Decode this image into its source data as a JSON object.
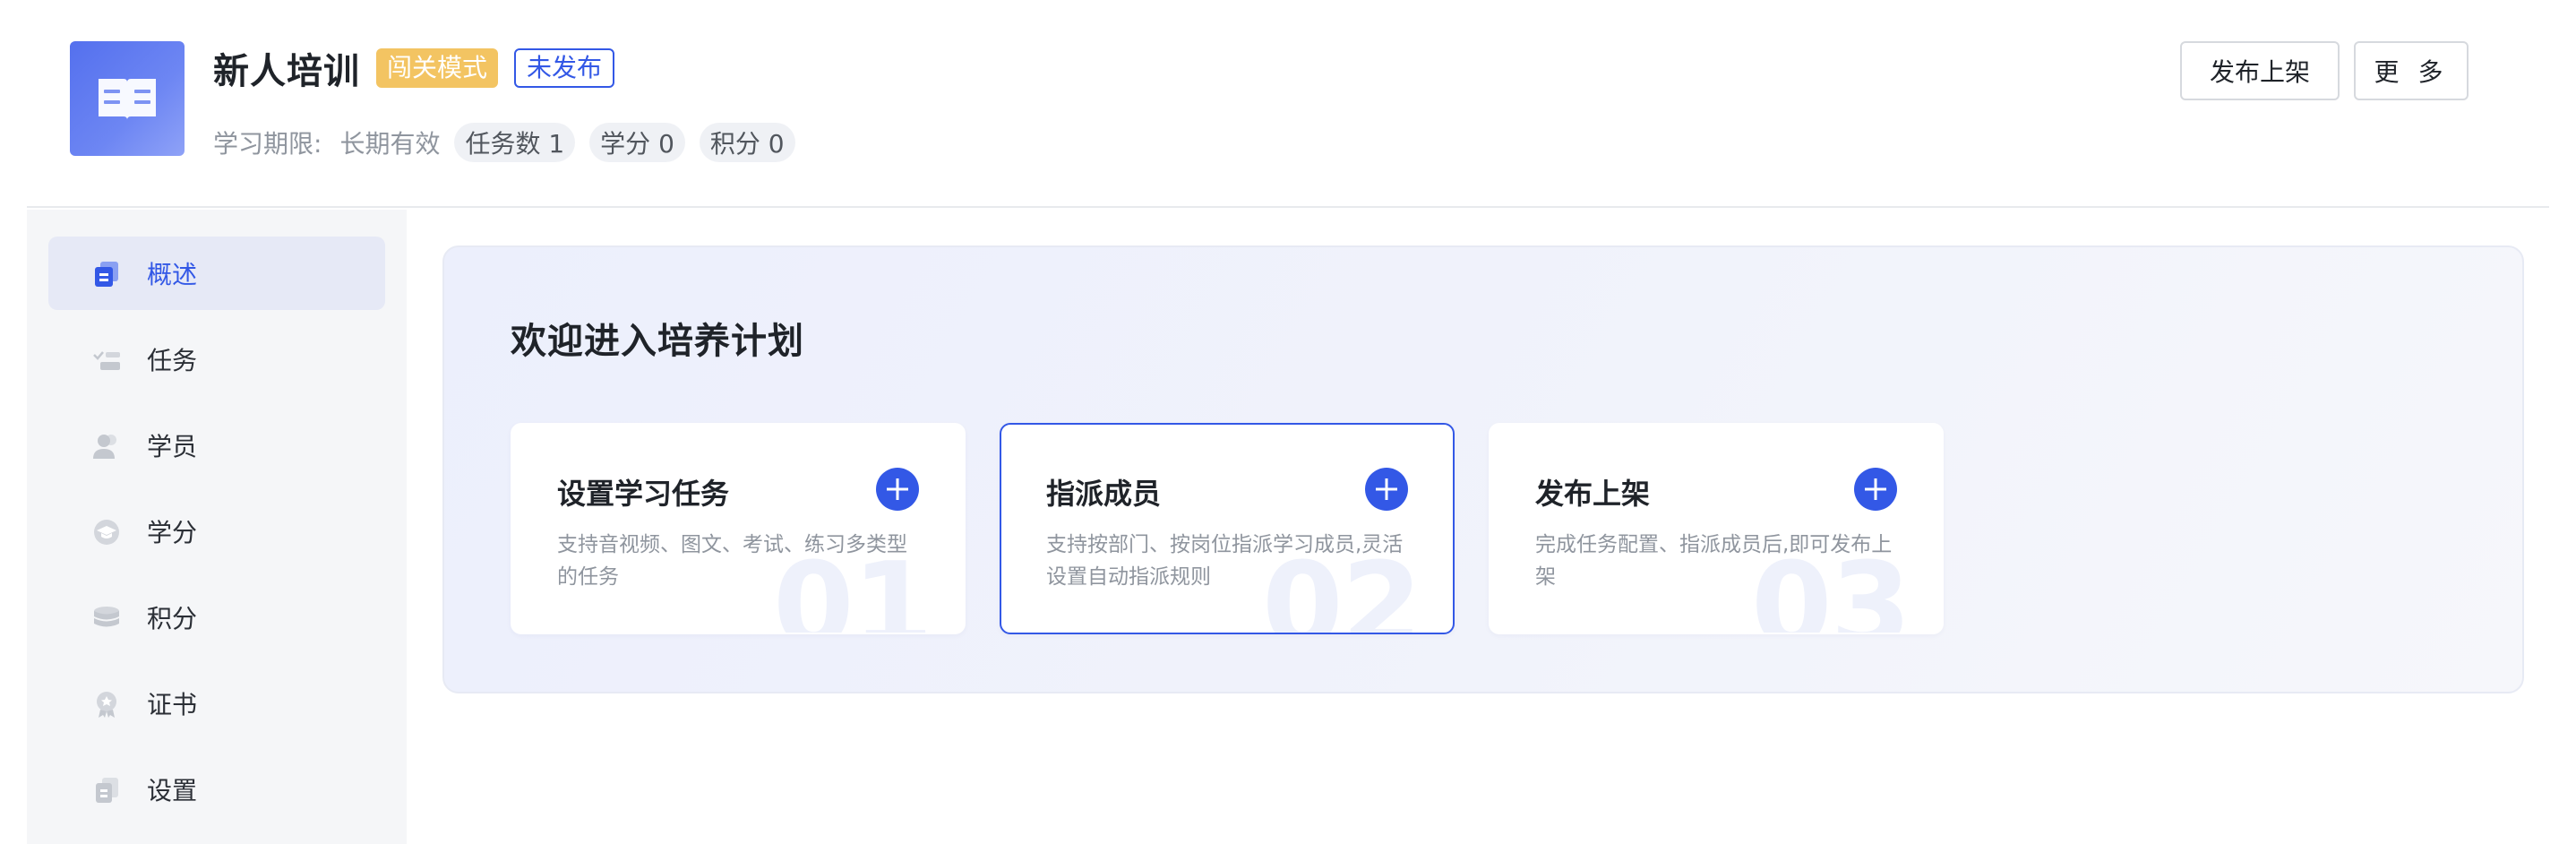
{
  "course": {
    "title": "新人培训",
    "mode_tag": "闯关模式",
    "status_tag": "未发布",
    "period_label": "学习期限:",
    "period_value": "长期有效",
    "pills": {
      "tasks": "任务数 1",
      "credits": "学分 0",
      "points": "积分 0"
    },
    "cover_icon": "open-book-icon"
  },
  "header_actions": {
    "publish": "发布上架",
    "more": "更 多"
  },
  "sidebar": {
    "items": [
      {
        "label": "概述",
        "icon": "overview-icon",
        "active": true
      },
      {
        "label": "任务",
        "icon": "task-list-icon",
        "active": false
      },
      {
        "label": "学员",
        "icon": "users-icon",
        "active": false
      },
      {
        "label": "学分",
        "icon": "graduation-cap-icon",
        "active": false
      },
      {
        "label": "积分",
        "icon": "coin-stack-icon",
        "active": false
      },
      {
        "label": "证书",
        "icon": "certificate-icon",
        "active": false
      },
      {
        "label": "设置",
        "icon": "settings-document-icon",
        "active": false
      }
    ]
  },
  "welcome": {
    "title": "欢迎进入培养计划",
    "steps": [
      {
        "title": "设置学习任务",
        "desc": "支持音视频、图文、考试、练习多类型的任务",
        "num": "01"
      },
      {
        "title": "指派成员",
        "desc": "支持按部门、按岗位指派学习成员,灵活设置自动指派规则",
        "num": "02"
      },
      {
        "title": "发布上架",
        "desc": "完成任务配置、指派成员后,即可发布上架",
        "num": "03"
      }
    ]
  },
  "colors": {
    "accent": "#3358e6",
    "mode_tag_bg": "#f3c462",
    "sidebar_bg": "#f5f6f8",
    "active_nav_bg": "#e6e9f6"
  }
}
